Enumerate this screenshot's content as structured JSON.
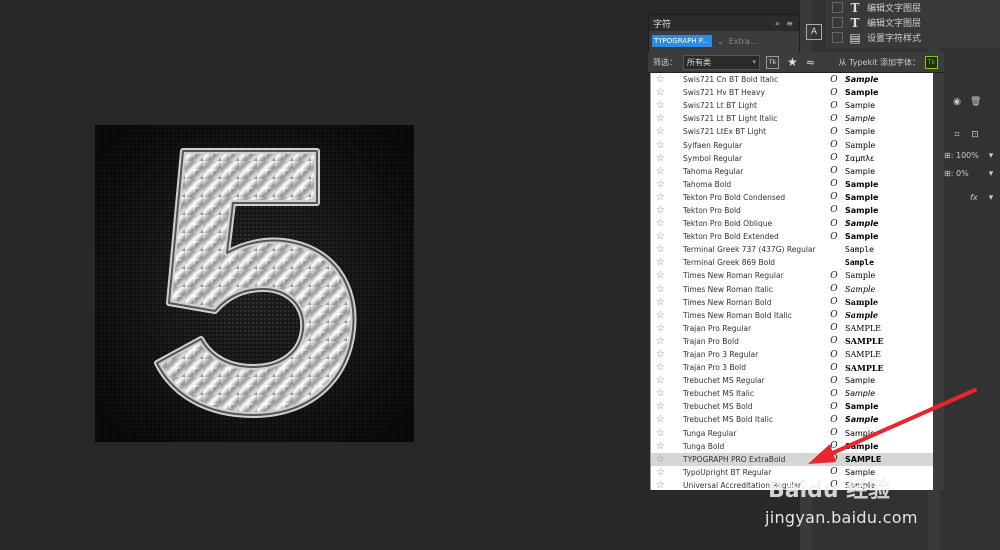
{
  "layers": {
    "items": [
      {
        "label": "编辑文字图层"
      },
      {
        "label": "编辑文字图层"
      },
      {
        "label": "设置字符样式"
      }
    ]
  },
  "char_panel": {
    "title": "字符",
    "current_font": "TYPOGRAPH P...",
    "current_style": "Extra..."
  },
  "filter_bar": {
    "label": "筛选：",
    "category": "所有类",
    "typekit_label": "从 Typekit 添加字体："
  },
  "font_list": [
    {
      "name": "Swis721 Cn BT Bold Italic",
      "sample": "Sample",
      "has_icon": true
    },
    {
      "name": "Swis721 Hv BT Heavy",
      "sample": "Sample",
      "has_icon": true
    },
    {
      "name": "Swis721 Lt BT Light",
      "sample": "Sample",
      "has_icon": true
    },
    {
      "name": "Swis721 Lt BT Light Italic",
      "sample": "Sample",
      "has_icon": true
    },
    {
      "name": "Swis721 LtEx BT Light",
      "sample": "Sample",
      "has_icon": true
    },
    {
      "name": "Sylfaen Regular",
      "sample": "Sample",
      "has_icon": true
    },
    {
      "name": "Symbol Regular",
      "sample": "Σαμπλε",
      "has_icon": true
    },
    {
      "name": "Tahoma Regular",
      "sample": "Sample",
      "has_icon": true
    },
    {
      "name": "Tahoma Bold",
      "sample": "Sample",
      "has_icon": true
    },
    {
      "name": "Tekton Pro Bold Condensed",
      "sample": "Sample",
      "has_icon": true
    },
    {
      "name": "Tekton Pro Bold",
      "sample": "Sample",
      "has_icon": true
    },
    {
      "name": "Tekton Pro Bold Oblique",
      "sample": "Sample",
      "has_icon": true
    },
    {
      "name": "Tekton Pro Bold Extended",
      "sample": "Sample",
      "has_icon": true
    },
    {
      "name": "Terminal Greek 737 (437G) Regular",
      "sample": "Sample",
      "has_icon": false
    },
    {
      "name": "Terminal Greek 869 Bold",
      "sample": "Sample",
      "has_icon": false
    },
    {
      "name": "Times New Roman Regular",
      "sample": "Sample",
      "has_icon": true
    },
    {
      "name": "Times New Roman Italic",
      "sample": "Sample",
      "has_icon": true
    },
    {
      "name": "Times New Roman Bold",
      "sample": "Sample",
      "has_icon": true
    },
    {
      "name": "Times New Roman Bold Italic",
      "sample": "Sample",
      "has_icon": true
    },
    {
      "name": "Trajan Pro Regular",
      "sample": "SAMPLE",
      "has_icon": true
    },
    {
      "name": "Trajan Pro Bold",
      "sample": "SAMPLE",
      "has_icon": true
    },
    {
      "name": "Trajan Pro 3 Regular",
      "sample": "SAMPLE",
      "has_icon": true
    },
    {
      "name": "Trajan Pro 3 Bold",
      "sample": "SAMPLE",
      "has_icon": true
    },
    {
      "name": "Trebuchet MS Regular",
      "sample": "Sample",
      "has_icon": true
    },
    {
      "name": "Trebuchet MS Italic",
      "sample": "Sample",
      "has_icon": true
    },
    {
      "name": "Trebuchet MS Bold",
      "sample": "Sample",
      "has_icon": true
    },
    {
      "name": "Trebuchet MS Bold Italic",
      "sample": "Sample",
      "has_icon": true
    },
    {
      "name": "Tunga Regular",
      "sample": "Sample",
      "has_icon": true
    },
    {
      "name": "Tunga Bold",
      "sample": "Sample",
      "has_icon": true
    },
    {
      "name": "TYPOGRAPH PRO ExtraBold",
      "sample": "SAMPLE",
      "has_icon": true,
      "selected": true
    },
    {
      "name": "TypoUpright BT Regular",
      "sample": "Sample",
      "has_icon": true
    },
    {
      "name": "Universal Accreditation Regular",
      "sample": "Sample",
      "has_icon": true
    }
  ],
  "properties": {
    "opacity": "100%",
    "fill": "0%",
    "fx": "fx"
  },
  "canvas": {
    "digit": "5"
  },
  "watermark": {
    "brand": "Baidu 经验",
    "url": "jingyan.baidu.com"
  },
  "colors": {
    "accent": "#2b8be5",
    "arrow": "#e8262b",
    "typekit": "#7aca1a"
  }
}
